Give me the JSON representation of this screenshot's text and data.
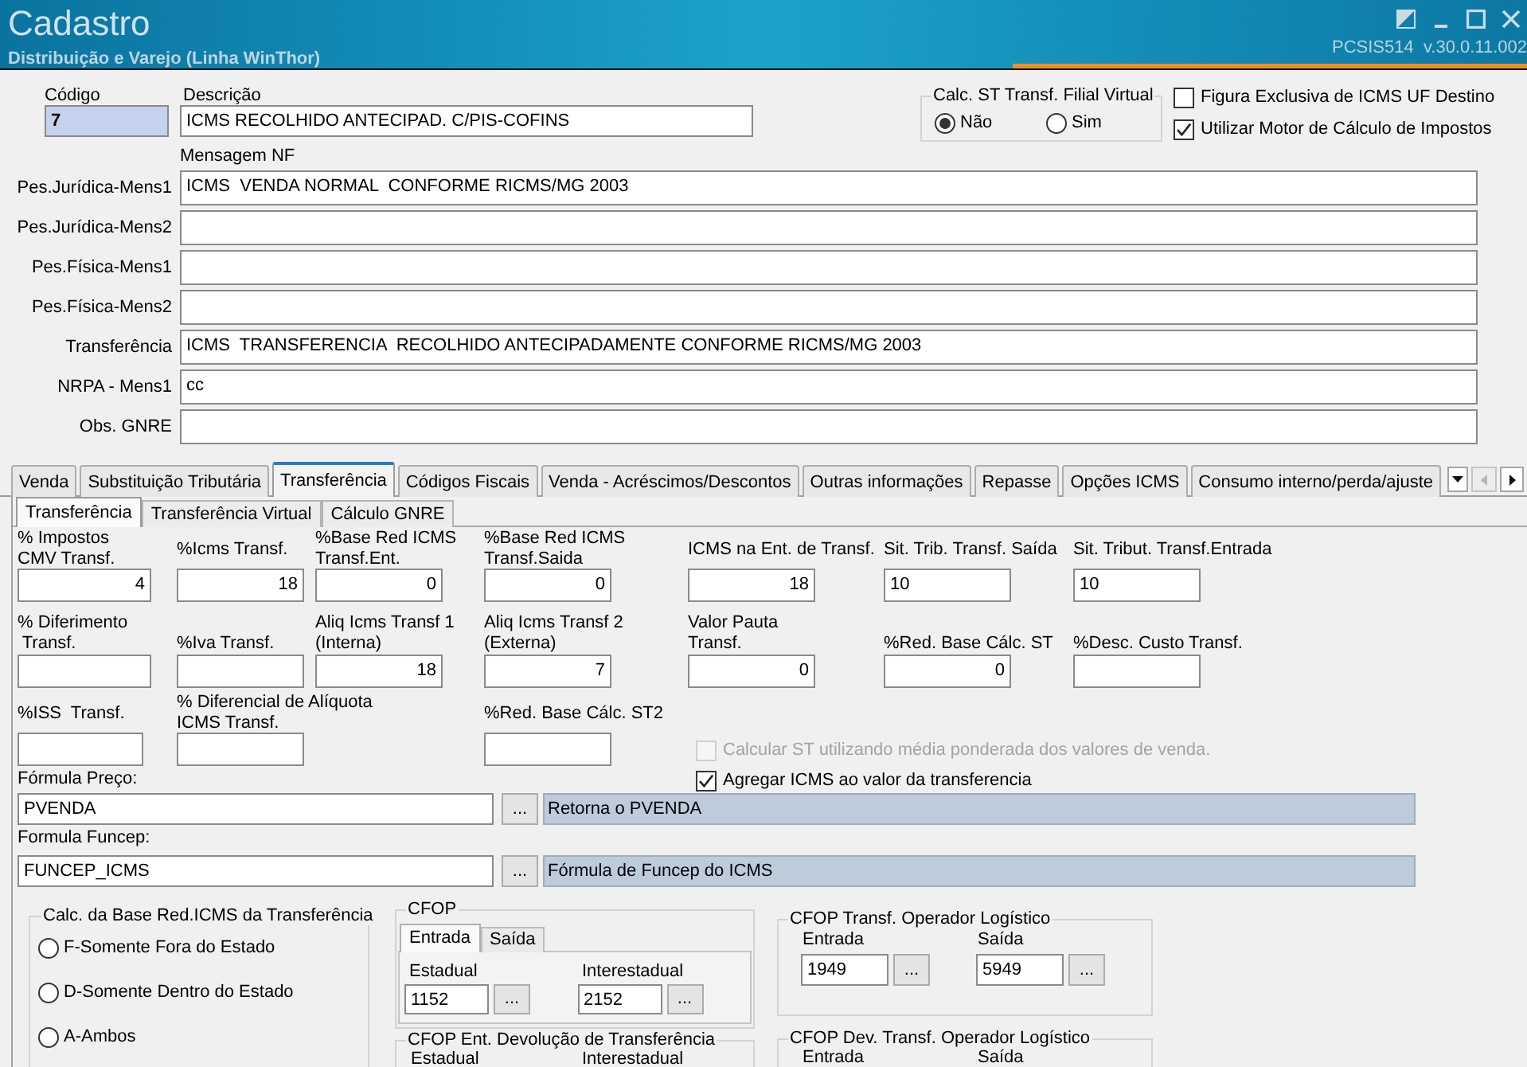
{
  "window": {
    "title": "Cadastro",
    "subtitle": "Distribuição e Varejo (Linha WinThor)",
    "version": "PCSIS514  v.30.0.11.002"
  },
  "header_fields": [
    {
      "label": "Código",
      "value": "7",
      "kind": "key"
    },
    {
      "label": "Descrição",
      "value": "ICMS RECOLHIDO ANTECIPAD. C/PIS-COFINS",
      "kind": "text"
    }
  ],
  "calc_st_virtual": {
    "title": "Calc. ST Transf. Filial Virtual",
    "options": [
      {
        "label": "Não",
        "selected": true
      },
      {
        "label": "Sim",
        "selected": false
      }
    ]
  },
  "header_checks": [
    {
      "label": "Figura Exclusiva de ICMS UF Destino",
      "checked": false
    },
    {
      "label": "Utilizar Motor de Cálculo de Impostos",
      "checked": true
    }
  ],
  "messages": {
    "heading": "Mensagem NF",
    "rows": [
      {
        "label": "Pes.Jurídica-Mens1",
        "value": "ICMS  VENDA NORMAL  CONFORME RICMS/MG 2003"
      },
      {
        "label": "Pes.Jurídica-Mens2"
      },
      {
        "label": "Pes.Física-Mens1"
      },
      {
        "label": "Pes.Física-Mens2"
      },
      {
        "label": "Transferência",
        "value": "ICMS  TRANSFERENCIA  RECOLHIDO ANTECIPADAMENTE CONFORME RICMS/MG 2003"
      },
      {
        "label": "NRPA - Mens1",
        "value": "cc"
      },
      {
        "label": "Obs. GNRE"
      }
    ]
  },
  "tabs": [
    {
      "label": "Venda",
      "selected": false
    },
    {
      "label": "Substituição Tributária",
      "selected": false
    },
    {
      "label": "Transferência",
      "selected": true
    },
    {
      "label": "Códigos Fiscais",
      "selected": false
    },
    {
      "label": "Venda - Acréscimos/Descontos",
      "selected": false
    },
    {
      "label": "Outras informações",
      "selected": false
    },
    {
      "label": "Repasse",
      "selected": false
    },
    {
      "label": "Opções ICMS",
      "selected": false
    },
    {
      "label": "Consumo interno/perda/ajuste",
      "selected": false
    }
  ],
  "tab_scroll": {
    "back_disabled": true,
    "forward_disabled": false
  },
  "subtabs": [
    {
      "label": "Transferência",
      "selected": true
    },
    {
      "label": "Transferência Virtual",
      "selected": false
    },
    {
      "label": "Cálculo GNRE",
      "selected": false
    }
  ],
  "field_rows": [
    {
      "fields": [
        {
          "label": "% Impostos\nCMV Transf.",
          "value": "4",
          "kind": "number"
        },
        {
          "label": "%Icms Transf.",
          "value": "18",
          "kind": "number"
        },
        {
          "label": "%Base Red ICMS\nTransf.Ent.",
          "value": "0",
          "kind": "number"
        },
        {
          "label": "%Base Red ICMS\nTransf.Saida",
          "value": "0",
          "kind": "number"
        },
        {
          "label": "ICMS na Ent. de Transf.",
          "value": "18",
          "kind": "number"
        },
        {
          "label": "Sit. Trib. Transf. Saída",
          "value": "10",
          "kind": "code"
        },
        {
          "label": "Sit. Tribut. Transf.Entrada",
          "value": "10",
          "kind": "code"
        }
      ]
    },
    {
      "fields": [
        {
          "label": "% Diferimento\n Transf.",
          "kind": "number"
        },
        {
          "label": "%Iva Transf.",
          "kind": "number"
        },
        {
          "label": "Aliq Icms Transf 1\n(Interna)",
          "value": "18",
          "kind": "number"
        },
        {
          "label": "Aliq Icms Transf 2\n(Externa)",
          "value": "7",
          "kind": "number"
        },
        {
          "label": "Valor Pauta\nTransf.",
          "value": "0",
          "kind": "number"
        },
        {
          "label": "%Red. Base Cálc. ST",
          "value": "0",
          "kind": "number"
        },
        {
          "label": "%Desc. Custo Transf.",
          "kind": "number"
        }
      ]
    },
    {
      "fields": [
        {
          "label": "%ISS  Transf.",
          "kind": "number"
        },
        {
          "label": "% Diferencial de Alíquota\nICMS Transf.",
          "kind": "number"
        },
        {
          "label": "%Red. Base Cálc. ST2",
          "kind": "number"
        }
      ]
    }
  ],
  "transfer_checks": [
    {
      "label": "Calcular ST utilizando média ponderada dos valores de venda.",
      "checked": false,
      "disabled": true
    },
    {
      "label": "Agregar ICMS ao valor da transferencia",
      "checked": true,
      "disabled": false
    }
  ],
  "formulas": [
    {
      "label": "Fórmula Preço:",
      "value": "PVENDA",
      "button": "...",
      "description": "Retorna o PVENDA"
    },
    {
      "label": "Formula Funcep:",
      "value": "FUNCEP_ICMS",
      "button": "...",
      "description": "Fórmula de Funcep do ICMS"
    }
  ],
  "base_red": {
    "title": "Calc. da Base Red.ICMS da Transferência",
    "options": [
      {
        "label": "F-Somente Fora do Estado",
        "selected": false
      },
      {
        "label": "D-Somente Dentro do Estado",
        "selected": false
      },
      {
        "label": "A-Ambos",
        "selected": false
      }
    ]
  },
  "cfop": {
    "title": "CFOP",
    "tabs": [
      {
        "label": "Entrada",
        "selected": true
      },
      {
        "label": "Saída",
        "selected": false
      }
    ],
    "fields": [
      {
        "label": "Estadual",
        "value": "1152",
        "button": "..."
      },
      {
        "label": "Interestadual",
        "value": "2152",
        "button": "..."
      }
    ]
  },
  "cfop_devolucao": {
    "title": "CFOP Ent. Devolução de Transferência",
    "labels": [
      "Estadual",
      "Interestadual"
    ]
  },
  "cfop_operador": {
    "title": "CFOP Transf. Operador Logístico",
    "fields": [
      {
        "label": "Entrada",
        "value": "1949",
        "button": "..."
      },
      {
        "label": "Saída",
        "value": "5949",
        "button": "..."
      }
    ]
  },
  "cfop_dev_operador": {
    "title": "CFOP Dev. Transf. Operador Logístico",
    "labels": [
      "Entrada",
      "Saída"
    ]
  }
}
